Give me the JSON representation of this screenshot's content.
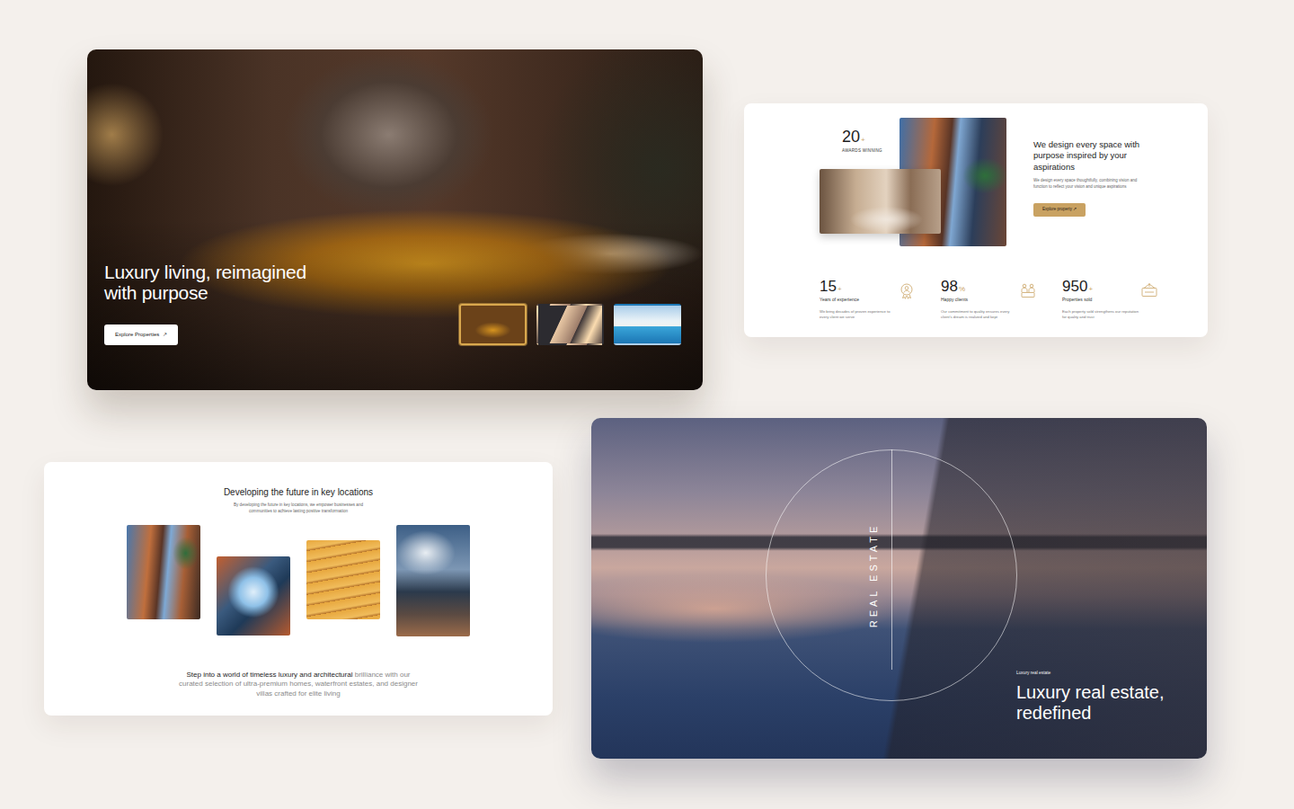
{
  "hero": {
    "title_lines": [
      "Luxury living, reimagined",
      "with purpose"
    ],
    "button": "Explore Properties",
    "button_icon": "↗",
    "thumbnails": [
      {
        "selected": true
      },
      {
        "selected": false
      },
      {
        "selected": false
      }
    ]
  },
  "about": {
    "award": {
      "value": "20",
      "suffix": "+",
      "label": "AWARDS WINNING"
    },
    "heading": "We design every space with purpose inspired by your aspirations",
    "body": "We design every space thoughtfully, combining vision and function to reflect your vision and unique aspirations",
    "button": "Explore property",
    "button_icon": "↗",
    "stats": [
      {
        "value": "15",
        "suffix": "+",
        "label": "Years of experience",
        "text": "We bring decades of proven experience to every client we serve"
      },
      {
        "value": "98",
        "suffix": "%",
        "label": "Happy clients",
        "text": "Our commitment to quality ensures every client's dream is realized and kept"
      },
      {
        "value": "950",
        "suffix": "+",
        "label": "Properties sold",
        "text": "Each property sold strengthens our reputation for quality and trust"
      }
    ]
  },
  "locations": {
    "title": "Developing the future in key locations",
    "subtitle": "By developing the future in key locations, we empower businesses and communities to achieve lasting positive transformation",
    "outro_strong": "Step into a world of timeless luxury and architectural",
    "outro_muted": "brilliance with our curated selection of ultra-premium homes, waterfront estates, and designer villas crafted for elite living"
  },
  "showcase": {
    "vertical": "REAL ESTATE",
    "eyebrow": "Luxury real estate",
    "title_lines": [
      "Luxury real estate,",
      "redefined"
    ]
  }
}
